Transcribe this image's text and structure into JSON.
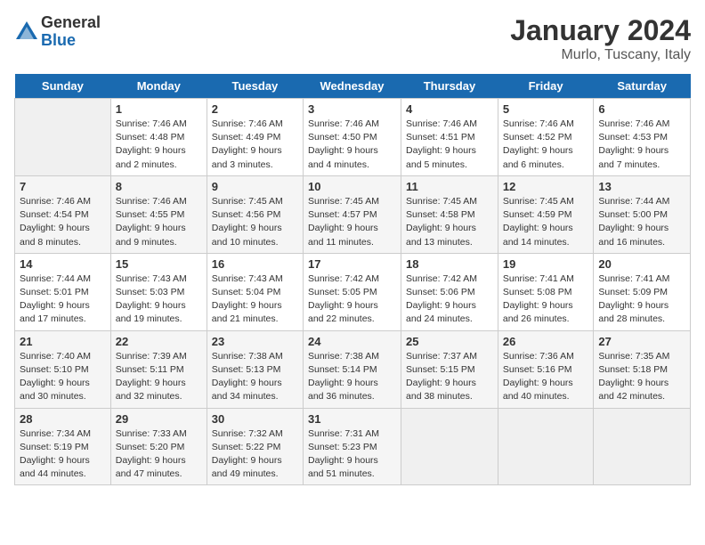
{
  "logo": {
    "general": "General",
    "blue": "Blue"
  },
  "title": "January 2024",
  "location": "Murlo, Tuscany, Italy",
  "days_of_week": [
    "Sunday",
    "Monday",
    "Tuesday",
    "Wednesday",
    "Thursday",
    "Friday",
    "Saturday"
  ],
  "weeks": [
    [
      {
        "day": "",
        "sunrise": "",
        "sunset": "",
        "daylight": ""
      },
      {
        "day": "1",
        "sunrise": "Sunrise: 7:46 AM",
        "sunset": "Sunset: 4:48 PM",
        "daylight": "Daylight: 9 hours and 2 minutes."
      },
      {
        "day": "2",
        "sunrise": "Sunrise: 7:46 AM",
        "sunset": "Sunset: 4:49 PM",
        "daylight": "Daylight: 9 hours and 3 minutes."
      },
      {
        "day": "3",
        "sunrise": "Sunrise: 7:46 AM",
        "sunset": "Sunset: 4:50 PM",
        "daylight": "Daylight: 9 hours and 4 minutes."
      },
      {
        "day": "4",
        "sunrise": "Sunrise: 7:46 AM",
        "sunset": "Sunset: 4:51 PM",
        "daylight": "Daylight: 9 hours and 5 minutes."
      },
      {
        "day": "5",
        "sunrise": "Sunrise: 7:46 AM",
        "sunset": "Sunset: 4:52 PM",
        "daylight": "Daylight: 9 hours and 6 minutes."
      },
      {
        "day": "6",
        "sunrise": "Sunrise: 7:46 AM",
        "sunset": "Sunset: 4:53 PM",
        "daylight": "Daylight: 9 hours and 7 minutes."
      }
    ],
    [
      {
        "day": "7",
        "sunrise": "Sunrise: 7:46 AM",
        "sunset": "Sunset: 4:54 PM",
        "daylight": "Daylight: 9 hours and 8 minutes."
      },
      {
        "day": "8",
        "sunrise": "Sunrise: 7:46 AM",
        "sunset": "Sunset: 4:55 PM",
        "daylight": "Daylight: 9 hours and 9 minutes."
      },
      {
        "day": "9",
        "sunrise": "Sunrise: 7:45 AM",
        "sunset": "Sunset: 4:56 PM",
        "daylight": "Daylight: 9 hours and 10 minutes."
      },
      {
        "day": "10",
        "sunrise": "Sunrise: 7:45 AM",
        "sunset": "Sunset: 4:57 PM",
        "daylight": "Daylight: 9 hours and 11 minutes."
      },
      {
        "day": "11",
        "sunrise": "Sunrise: 7:45 AM",
        "sunset": "Sunset: 4:58 PM",
        "daylight": "Daylight: 9 hours and 13 minutes."
      },
      {
        "day": "12",
        "sunrise": "Sunrise: 7:45 AM",
        "sunset": "Sunset: 4:59 PM",
        "daylight": "Daylight: 9 hours and 14 minutes."
      },
      {
        "day": "13",
        "sunrise": "Sunrise: 7:44 AM",
        "sunset": "Sunset: 5:00 PM",
        "daylight": "Daylight: 9 hours and 16 minutes."
      }
    ],
    [
      {
        "day": "14",
        "sunrise": "Sunrise: 7:44 AM",
        "sunset": "Sunset: 5:01 PM",
        "daylight": "Daylight: 9 hours and 17 minutes."
      },
      {
        "day": "15",
        "sunrise": "Sunrise: 7:43 AM",
        "sunset": "Sunset: 5:03 PM",
        "daylight": "Daylight: 9 hours and 19 minutes."
      },
      {
        "day": "16",
        "sunrise": "Sunrise: 7:43 AM",
        "sunset": "Sunset: 5:04 PM",
        "daylight": "Daylight: 9 hours and 21 minutes."
      },
      {
        "day": "17",
        "sunrise": "Sunrise: 7:42 AM",
        "sunset": "Sunset: 5:05 PM",
        "daylight": "Daylight: 9 hours and 22 minutes."
      },
      {
        "day": "18",
        "sunrise": "Sunrise: 7:42 AM",
        "sunset": "Sunset: 5:06 PM",
        "daylight": "Daylight: 9 hours and 24 minutes."
      },
      {
        "day": "19",
        "sunrise": "Sunrise: 7:41 AM",
        "sunset": "Sunset: 5:08 PM",
        "daylight": "Daylight: 9 hours and 26 minutes."
      },
      {
        "day": "20",
        "sunrise": "Sunrise: 7:41 AM",
        "sunset": "Sunset: 5:09 PM",
        "daylight": "Daylight: 9 hours and 28 minutes."
      }
    ],
    [
      {
        "day": "21",
        "sunrise": "Sunrise: 7:40 AM",
        "sunset": "Sunset: 5:10 PM",
        "daylight": "Daylight: 9 hours and 30 minutes."
      },
      {
        "day": "22",
        "sunrise": "Sunrise: 7:39 AM",
        "sunset": "Sunset: 5:11 PM",
        "daylight": "Daylight: 9 hours and 32 minutes."
      },
      {
        "day": "23",
        "sunrise": "Sunrise: 7:38 AM",
        "sunset": "Sunset: 5:13 PM",
        "daylight": "Daylight: 9 hours and 34 minutes."
      },
      {
        "day": "24",
        "sunrise": "Sunrise: 7:38 AM",
        "sunset": "Sunset: 5:14 PM",
        "daylight": "Daylight: 9 hours and 36 minutes."
      },
      {
        "day": "25",
        "sunrise": "Sunrise: 7:37 AM",
        "sunset": "Sunset: 5:15 PM",
        "daylight": "Daylight: 9 hours and 38 minutes."
      },
      {
        "day": "26",
        "sunrise": "Sunrise: 7:36 AM",
        "sunset": "Sunset: 5:16 PM",
        "daylight": "Daylight: 9 hours and 40 minutes."
      },
      {
        "day": "27",
        "sunrise": "Sunrise: 7:35 AM",
        "sunset": "Sunset: 5:18 PM",
        "daylight": "Daylight: 9 hours and 42 minutes."
      }
    ],
    [
      {
        "day": "28",
        "sunrise": "Sunrise: 7:34 AM",
        "sunset": "Sunset: 5:19 PM",
        "daylight": "Daylight: 9 hours and 44 minutes."
      },
      {
        "day": "29",
        "sunrise": "Sunrise: 7:33 AM",
        "sunset": "Sunset: 5:20 PM",
        "daylight": "Daylight: 9 hours and 47 minutes."
      },
      {
        "day": "30",
        "sunrise": "Sunrise: 7:32 AM",
        "sunset": "Sunset: 5:22 PM",
        "daylight": "Daylight: 9 hours and 49 minutes."
      },
      {
        "day": "31",
        "sunrise": "Sunrise: 7:31 AM",
        "sunset": "Sunset: 5:23 PM",
        "daylight": "Daylight: 9 hours and 51 minutes."
      },
      {
        "day": "",
        "sunrise": "",
        "sunset": "",
        "daylight": ""
      },
      {
        "day": "",
        "sunrise": "",
        "sunset": "",
        "daylight": ""
      },
      {
        "day": "",
        "sunrise": "",
        "sunset": "",
        "daylight": ""
      }
    ]
  ]
}
